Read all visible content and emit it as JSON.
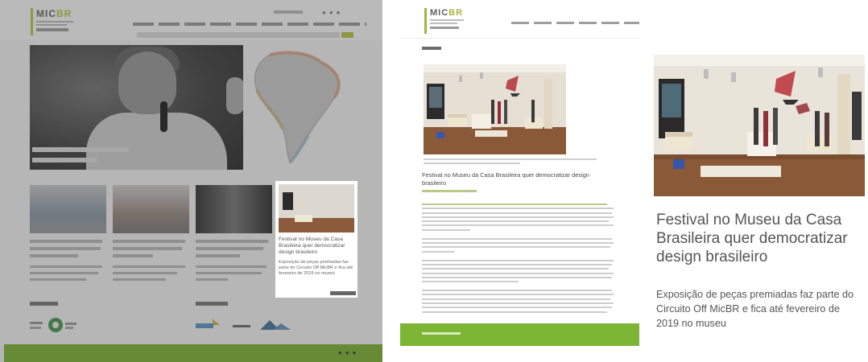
{
  "article": {
    "title": "Festival no Museu da Casa Brasileira quer democratizar design brasileiro",
    "summary": "Exposição de peças premiadas faz parte do Circuito Off MicBR e fica até fevereiro de 2019 no museu"
  },
  "logo": {
    "text_dark": "MIC",
    "text_accent": "BR"
  },
  "colors": {
    "brand_green": "#7db534",
    "logo_accent": "#a6b43c"
  },
  "icons": {
    "social": "social-icons",
    "map": "south-america-map"
  }
}
